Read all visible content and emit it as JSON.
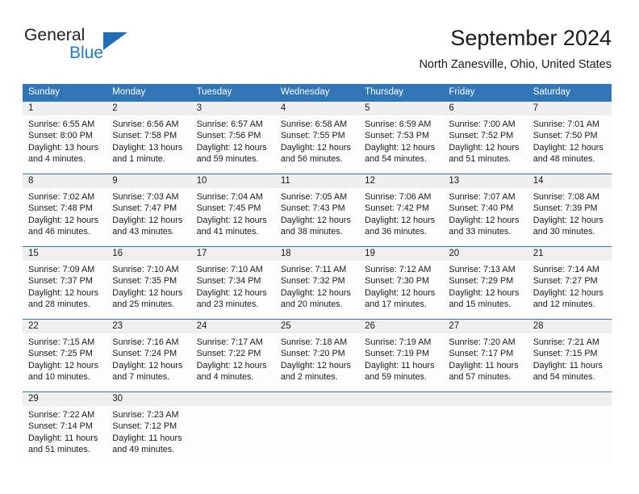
{
  "brand": {
    "name_part1": "General",
    "name_part2": "Blue",
    "logo_icon": "triangle-logo-icon"
  },
  "header": {
    "title": "September 2024",
    "location": "North Zanesville, Ohio, United States"
  },
  "theme": {
    "accent_blue": "#3276b8",
    "brand_blue": "#1f7ac4",
    "strip_gray": "#efefef",
    "header_text": "#ffffff"
  },
  "calendar": {
    "day_headers": [
      "Sunday",
      "Monday",
      "Tuesday",
      "Wednesday",
      "Thursday",
      "Friday",
      "Saturday"
    ],
    "weeks": [
      {
        "days": [
          {
            "date": "1",
            "sunrise": "Sunrise: 6:55 AM",
            "sunset": "Sunset: 8:00 PM",
            "daylight1": "Daylight: 13 hours",
            "daylight2": "and 4 minutes."
          },
          {
            "date": "2",
            "sunrise": "Sunrise: 6:56 AM",
            "sunset": "Sunset: 7:58 PM",
            "daylight1": "Daylight: 13 hours",
            "daylight2": "and 1 minute."
          },
          {
            "date": "3",
            "sunrise": "Sunrise: 6:57 AM",
            "sunset": "Sunset: 7:56 PM",
            "daylight1": "Daylight: 12 hours",
            "daylight2": "and 59 minutes."
          },
          {
            "date": "4",
            "sunrise": "Sunrise: 6:58 AM",
            "sunset": "Sunset: 7:55 PM",
            "daylight1": "Daylight: 12 hours",
            "daylight2": "and 56 minutes."
          },
          {
            "date": "5",
            "sunrise": "Sunrise: 6:59 AM",
            "sunset": "Sunset: 7:53 PM",
            "daylight1": "Daylight: 12 hours",
            "daylight2": "and 54 minutes."
          },
          {
            "date": "6",
            "sunrise": "Sunrise: 7:00 AM",
            "sunset": "Sunset: 7:52 PM",
            "daylight1": "Daylight: 12 hours",
            "daylight2": "and 51 minutes."
          },
          {
            "date": "7",
            "sunrise": "Sunrise: 7:01 AM",
            "sunset": "Sunset: 7:50 PM",
            "daylight1": "Daylight: 12 hours",
            "daylight2": "and 48 minutes."
          }
        ]
      },
      {
        "days": [
          {
            "date": "8",
            "sunrise": "Sunrise: 7:02 AM",
            "sunset": "Sunset: 7:48 PM",
            "daylight1": "Daylight: 12 hours",
            "daylight2": "and 46 minutes."
          },
          {
            "date": "9",
            "sunrise": "Sunrise: 7:03 AM",
            "sunset": "Sunset: 7:47 PM",
            "daylight1": "Daylight: 12 hours",
            "daylight2": "and 43 minutes."
          },
          {
            "date": "10",
            "sunrise": "Sunrise: 7:04 AM",
            "sunset": "Sunset: 7:45 PM",
            "daylight1": "Daylight: 12 hours",
            "daylight2": "and 41 minutes."
          },
          {
            "date": "11",
            "sunrise": "Sunrise: 7:05 AM",
            "sunset": "Sunset: 7:43 PM",
            "daylight1": "Daylight: 12 hours",
            "daylight2": "and 38 minutes."
          },
          {
            "date": "12",
            "sunrise": "Sunrise: 7:06 AM",
            "sunset": "Sunset: 7:42 PM",
            "daylight1": "Daylight: 12 hours",
            "daylight2": "and 36 minutes."
          },
          {
            "date": "13",
            "sunrise": "Sunrise: 7:07 AM",
            "sunset": "Sunset: 7:40 PM",
            "daylight1": "Daylight: 12 hours",
            "daylight2": "and 33 minutes."
          },
          {
            "date": "14",
            "sunrise": "Sunrise: 7:08 AM",
            "sunset": "Sunset: 7:39 PM",
            "daylight1": "Daylight: 12 hours",
            "daylight2": "and 30 minutes."
          }
        ]
      },
      {
        "days": [
          {
            "date": "15",
            "sunrise": "Sunrise: 7:09 AM",
            "sunset": "Sunset: 7:37 PM",
            "daylight1": "Daylight: 12 hours",
            "daylight2": "and 28 minutes."
          },
          {
            "date": "16",
            "sunrise": "Sunrise: 7:10 AM",
            "sunset": "Sunset: 7:35 PM",
            "daylight1": "Daylight: 12 hours",
            "daylight2": "and 25 minutes."
          },
          {
            "date": "17",
            "sunrise": "Sunrise: 7:10 AM",
            "sunset": "Sunset: 7:34 PM",
            "daylight1": "Daylight: 12 hours",
            "daylight2": "and 23 minutes."
          },
          {
            "date": "18",
            "sunrise": "Sunrise: 7:11 AM",
            "sunset": "Sunset: 7:32 PM",
            "daylight1": "Daylight: 12 hours",
            "daylight2": "and 20 minutes."
          },
          {
            "date": "19",
            "sunrise": "Sunrise: 7:12 AM",
            "sunset": "Sunset: 7:30 PM",
            "daylight1": "Daylight: 12 hours",
            "daylight2": "and 17 minutes."
          },
          {
            "date": "20",
            "sunrise": "Sunrise: 7:13 AM",
            "sunset": "Sunset: 7:29 PM",
            "daylight1": "Daylight: 12 hours",
            "daylight2": "and 15 minutes."
          },
          {
            "date": "21",
            "sunrise": "Sunrise: 7:14 AM",
            "sunset": "Sunset: 7:27 PM",
            "daylight1": "Daylight: 12 hours",
            "daylight2": "and 12 minutes."
          }
        ]
      },
      {
        "days": [
          {
            "date": "22",
            "sunrise": "Sunrise: 7:15 AM",
            "sunset": "Sunset: 7:25 PM",
            "daylight1": "Daylight: 12 hours",
            "daylight2": "and 10 minutes."
          },
          {
            "date": "23",
            "sunrise": "Sunrise: 7:16 AM",
            "sunset": "Sunset: 7:24 PM",
            "daylight1": "Daylight: 12 hours",
            "daylight2": "and 7 minutes."
          },
          {
            "date": "24",
            "sunrise": "Sunrise: 7:17 AM",
            "sunset": "Sunset: 7:22 PM",
            "daylight1": "Daylight: 12 hours",
            "daylight2": "and 4 minutes."
          },
          {
            "date": "25",
            "sunrise": "Sunrise: 7:18 AM",
            "sunset": "Sunset: 7:20 PM",
            "daylight1": "Daylight: 12 hours",
            "daylight2": "and 2 minutes."
          },
          {
            "date": "26",
            "sunrise": "Sunrise: 7:19 AM",
            "sunset": "Sunset: 7:19 PM",
            "daylight1": "Daylight: 11 hours",
            "daylight2": "and 59 minutes."
          },
          {
            "date": "27",
            "sunrise": "Sunrise: 7:20 AM",
            "sunset": "Sunset: 7:17 PM",
            "daylight1": "Daylight: 11 hours",
            "daylight2": "and 57 minutes."
          },
          {
            "date": "28",
            "sunrise": "Sunrise: 7:21 AM",
            "sunset": "Sunset: 7:15 PM",
            "daylight1": "Daylight: 11 hours",
            "daylight2": "and 54 minutes."
          }
        ]
      },
      {
        "days": [
          {
            "date": "29",
            "sunrise": "Sunrise: 7:22 AM",
            "sunset": "Sunset: 7:14 PM",
            "daylight1": "Daylight: 11 hours",
            "daylight2": "and 51 minutes."
          },
          {
            "date": "30",
            "sunrise": "Sunrise: 7:23 AM",
            "sunset": "Sunset: 7:12 PM",
            "daylight1": "Daylight: 11 hours",
            "daylight2": "and 49 minutes."
          },
          {
            "date": "",
            "sunrise": "",
            "sunset": "",
            "daylight1": "",
            "daylight2": ""
          },
          {
            "date": "",
            "sunrise": "",
            "sunset": "",
            "daylight1": "",
            "daylight2": ""
          },
          {
            "date": "",
            "sunrise": "",
            "sunset": "",
            "daylight1": "",
            "daylight2": ""
          },
          {
            "date": "",
            "sunrise": "",
            "sunset": "",
            "daylight1": "",
            "daylight2": ""
          },
          {
            "date": "",
            "sunrise": "",
            "sunset": "",
            "daylight1": "",
            "daylight2": ""
          }
        ]
      }
    ]
  }
}
